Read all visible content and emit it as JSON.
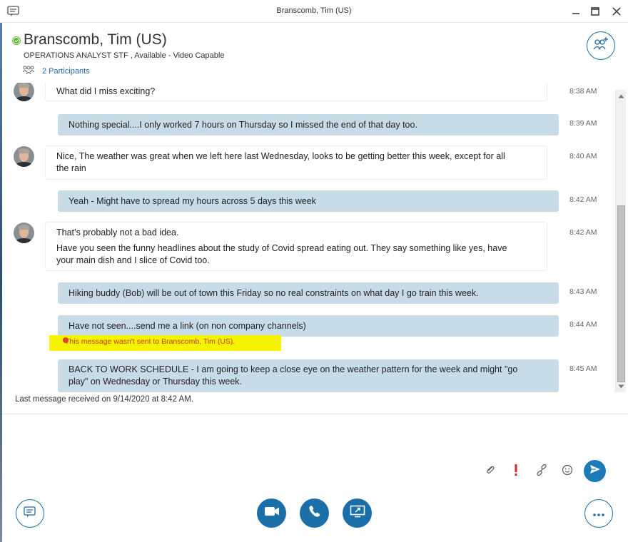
{
  "window": {
    "title": "Branscomb, Tim (US)"
  },
  "header": {
    "contact_name": "Branscomb, Tim (US)",
    "contact_title": "OPERATIONS ANALYST STF ,  Available - Video Capable",
    "participants_label": "2 Participants",
    "presence_color": "#5cb837"
  },
  "messages": [
    {
      "direction": "in",
      "lines": [
        "What did I miss exciting?"
      ],
      "time": "8:38 AM"
    },
    {
      "direction": "out",
      "lines": [
        "Nothing special....I only worked 7 hours on Thursday so I missed the end of that day too."
      ],
      "time": "8:39 AM"
    },
    {
      "direction": "in",
      "lines": [
        "Nice, The weather was great when we left here last Wednesday, looks to be getting better this week, except for all",
        "the rain"
      ],
      "time": "8:40 AM"
    },
    {
      "direction": "out",
      "lines": [
        "Yeah - Might have to spread my hours across 5 days this week"
      ],
      "time": "8:42 AM"
    },
    {
      "direction": "in",
      "lines": [
        "That’s probably not a bad idea.",
        "Have you seen the funny headlines about the study of Covid spread eating out. They say something like yes, have",
        "your main dish and I slice of Covid too."
      ],
      "time": "8:42 AM"
    },
    {
      "direction": "out",
      "lines": [
        "Hiking buddy (Bob) will be out of town this Friday so no real constraints on what day I go train this week."
      ],
      "time": "8:43 AM"
    },
    {
      "direction": "out",
      "lines": [
        "Have not seen....send me a link (on non company channels)"
      ],
      "time": "8:44 AM"
    },
    {
      "direction": "out",
      "lines": [
        "BACK TO WORK SCHEDULE - I am going to keep a close eye on the weather pattern for the week and might \"go",
        "play\" on Wednesday or Thursday this week."
      ],
      "time": "8:45 AM"
    }
  ],
  "failed_notice": "This message wasn't sent to Branscomb, Tim (US).",
  "status": {
    "last_received": "Last message received on 9/14/2020 at 8:42 AM."
  },
  "compose": {
    "placeholder": ""
  },
  "colors": {
    "accent": "#1b6fa8",
    "outgoing_bubble": "#c8dce8",
    "highlight": "#f7f400",
    "error": "#d9452b"
  },
  "icons": {
    "app": "chat-app-icon",
    "minimize": "minimize-icon",
    "maximize": "maximize-icon",
    "close": "close-icon",
    "participants": "people-icon",
    "add_people": "add-people-icon",
    "attach": "paperclip-icon",
    "importance": "exclamation-icon",
    "link": "link-icon",
    "emoji": "smiley-icon",
    "send": "send-icon",
    "im": "chat-bubble-icon",
    "video": "video-camera-icon",
    "call": "phone-icon",
    "share": "present-screen-icon",
    "more": "more-options-icon"
  }
}
